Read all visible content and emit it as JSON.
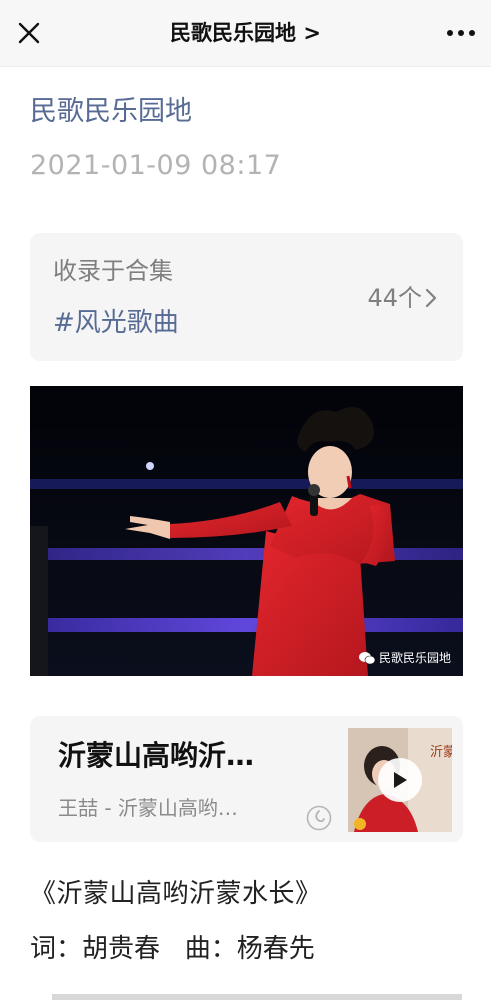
{
  "topbar": {
    "title": "民歌民乐园地 >",
    "close_icon": "close-icon",
    "more_icon": "more-dots-icon"
  },
  "article": {
    "account_name": "民歌民乐园地",
    "timestamp": "2021-01-09 08:17"
  },
  "collection": {
    "label": "收录于合集",
    "tag": "#风光歌曲",
    "count": "44个"
  },
  "photo": {
    "watermark": "民歌民乐园地",
    "watermark_icon": "wechat-icon"
  },
  "music": {
    "title": "沂蒙山高哟沂…",
    "subtitle": "王喆 - 沂蒙山高哟…",
    "logo_icon": "music-app-icon",
    "play_icon": "play-icon"
  },
  "body": {
    "lyric_title": "《沂蒙山高哟沂蒙水长》",
    "credits": "词：胡贵春   曲：杨春先"
  },
  "colors": {
    "link": "#576b95",
    "muted": "#b3b3b3",
    "card_bg": "#f5f5f5",
    "dress_red": "#d8232a"
  }
}
